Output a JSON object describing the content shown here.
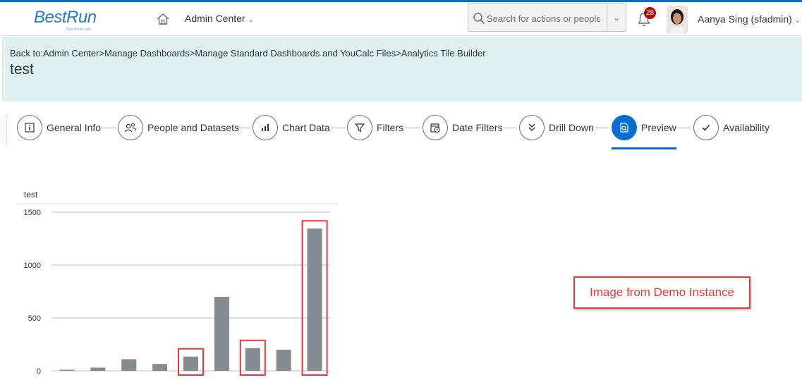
{
  "shell": {
    "logo_text": "BestRun",
    "logo_tagline": "Run simple with",
    "admin_menu_label": "Admin Center",
    "search_placeholder": "Search for actions or people",
    "notification_count": "28",
    "user_name": "Aanya Sing (sfadmin)"
  },
  "header": {
    "breadcrumb": [
      "Back to:",
      "Admin Center",
      ">",
      "Manage Dashboards",
      ">",
      "Manage Standard Dashboards and YouCalc Files",
      ">",
      "Analytics Tile Builder"
    ],
    "title": "test"
  },
  "wizard": {
    "steps": [
      {
        "label": "General Info",
        "icon": "info-icon"
      },
      {
        "label": "People and Datasets",
        "icon": "people-icon"
      },
      {
        "label": "Chart Data",
        "icon": "bar-chart-icon"
      },
      {
        "label": "Filters",
        "icon": "filter-icon"
      },
      {
        "label": "Date Filters",
        "icon": "calendar-clock-icon"
      },
      {
        "label": "Drill Down",
        "icon": "double-chevron-down-icon"
      },
      {
        "label": "Preview",
        "icon": "document-search-icon"
      },
      {
        "label": "Availability",
        "icon": "checkmark-icon"
      }
    ],
    "active_step": "Preview"
  },
  "chart_data": {
    "type": "bar",
    "title": "test",
    "ylim": [
      0,
      1500
    ],
    "yticks": [
      0,
      500,
      1000,
      1500
    ],
    "categories": [
      "",
      "",
      "",
      "",
      "",
      "",
      "",
      "",
      ""
    ],
    "values": [
      10,
      30,
      110,
      65,
      135,
      700,
      215,
      200,
      1345
    ],
    "bar_color": "#848b91",
    "grid": true,
    "highlighted_indices": [
      4,
      6,
      8
    ],
    "highlight_color": "#e03a3a"
  },
  "annotation": {
    "text": "Image from Demo Instance",
    "color": "#e03a3a"
  },
  "colors": {
    "accent": "#0a6ed1",
    "header_band": "#dff0f0",
    "badge": "#bb0000"
  }
}
